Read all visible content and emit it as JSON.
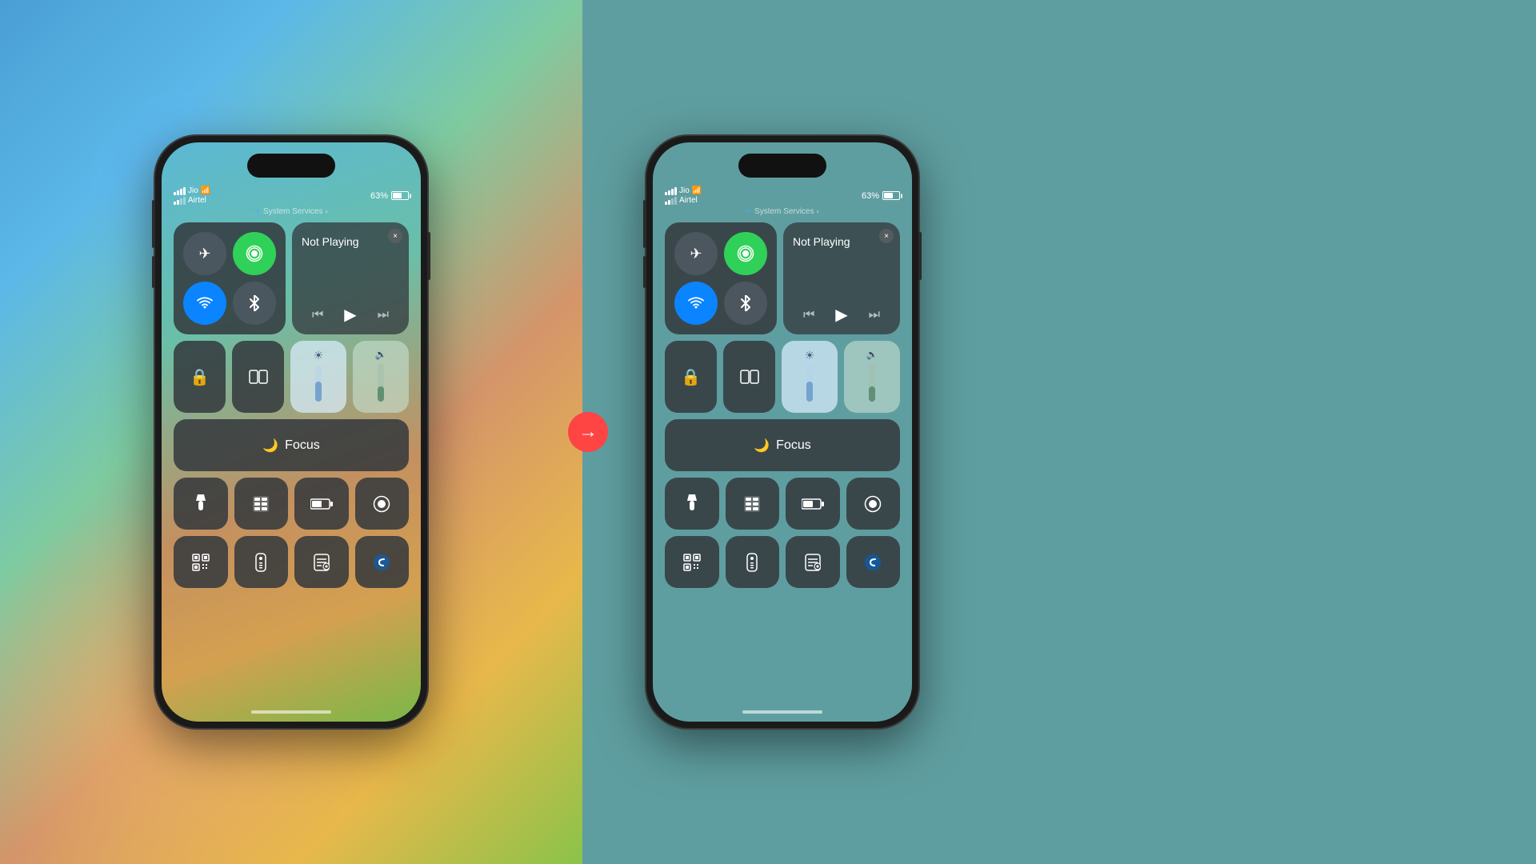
{
  "left_panel": {
    "phone": {
      "system_services": "System Services",
      "status": {
        "carrier1": "Jio",
        "carrier2": "Airtel",
        "battery": "63%"
      },
      "control_center": {
        "media": {
          "not_playing": "Not Playing",
          "close": "×"
        },
        "focus": {
          "label": "Focus"
        }
      }
    }
  },
  "right_panel": {
    "phone": {
      "system_services": "System Services",
      "status": {
        "carrier1": "Jio",
        "carrier2": "Airtel",
        "battery": "63%"
      },
      "control_center": {
        "media": {
          "not_playing": "Not Playing",
          "close": "×"
        },
        "focus": {
          "label": "Focus"
        }
      }
    }
  },
  "arrow": {
    "direction": "→"
  },
  "icons": {
    "airplane": "✈",
    "cellular": "📶",
    "wifi": "wifi",
    "bluetooth": "bluetooth",
    "play": "▶",
    "rewind": "⏮",
    "forward": "⏭",
    "lock_rotation": "🔒",
    "mirror": "mirror",
    "focus_moon": "🌙",
    "focus_label": "Focus",
    "sun": "☀",
    "volume": "🔊",
    "flashlight": "flashlight",
    "calculator": "calculator",
    "battery_saver": "battery",
    "screen_record": "record",
    "qr": "qr",
    "remote": "remote",
    "notes": "notes",
    "shazam": "shazam"
  }
}
